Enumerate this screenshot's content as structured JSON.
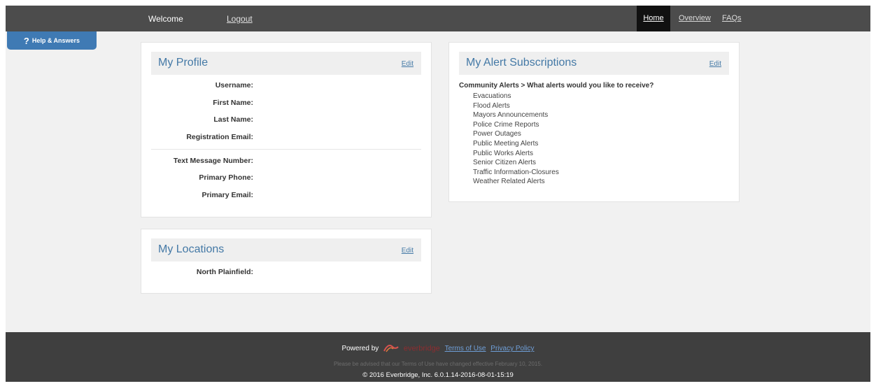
{
  "header": {
    "welcome": "Welcome",
    "logout": "Logout",
    "nav": [
      {
        "label": "Home"
      },
      {
        "label": "Overview"
      },
      {
        "label": "FAQs"
      }
    ]
  },
  "help_tab": {
    "icon": "?",
    "label": "Help & Answers"
  },
  "profile": {
    "title": "My Profile",
    "edit": "Edit",
    "fields": [
      {
        "label": "Username:"
      },
      {
        "label": "First Name:"
      },
      {
        "label": "Last Name:"
      },
      {
        "label": "Registration Email:"
      },
      {
        "label": "Text Message Number:"
      },
      {
        "label": "Primary Phone:"
      },
      {
        "label": "Primary Email:"
      }
    ]
  },
  "locations": {
    "title": "My Locations",
    "edit": "Edit",
    "fields": [
      {
        "label": "North Plainfield:"
      }
    ]
  },
  "subscriptions": {
    "title": "My Alert Subscriptions",
    "edit": "Edit",
    "heading": "Community Alerts > What alerts would you like to receive?",
    "items": [
      "Evacuations",
      "Flood Alerts",
      "Mayors Announcements",
      "Police Crime Reports",
      "Power Outages",
      "Public Meeting Alerts",
      "Public Works Alerts",
      "Senior Citizen Alerts",
      "Traffic Information-Closures",
      "Weather Related Alerts"
    ]
  },
  "footer": {
    "powered_by": "Powered by",
    "logo_text": "everbridge",
    "terms": "Terms of Use",
    "privacy": "Privacy Policy",
    "notice": "Please be advised that our Terms of Use have changed effective February 10, 2015.",
    "copyright": "2016 Everbridge, Inc. 6.0.1.14-2016-08-01-15:19",
    "copyright_symbol": "©"
  },
  "colors": {
    "header_bg": "#4c4c4c",
    "accent_blue": "#4479a6",
    "help_tab_bg": "#3f7ab4",
    "footer_bg": "#3f3f3f",
    "page_bg": "#f1f1f1"
  }
}
